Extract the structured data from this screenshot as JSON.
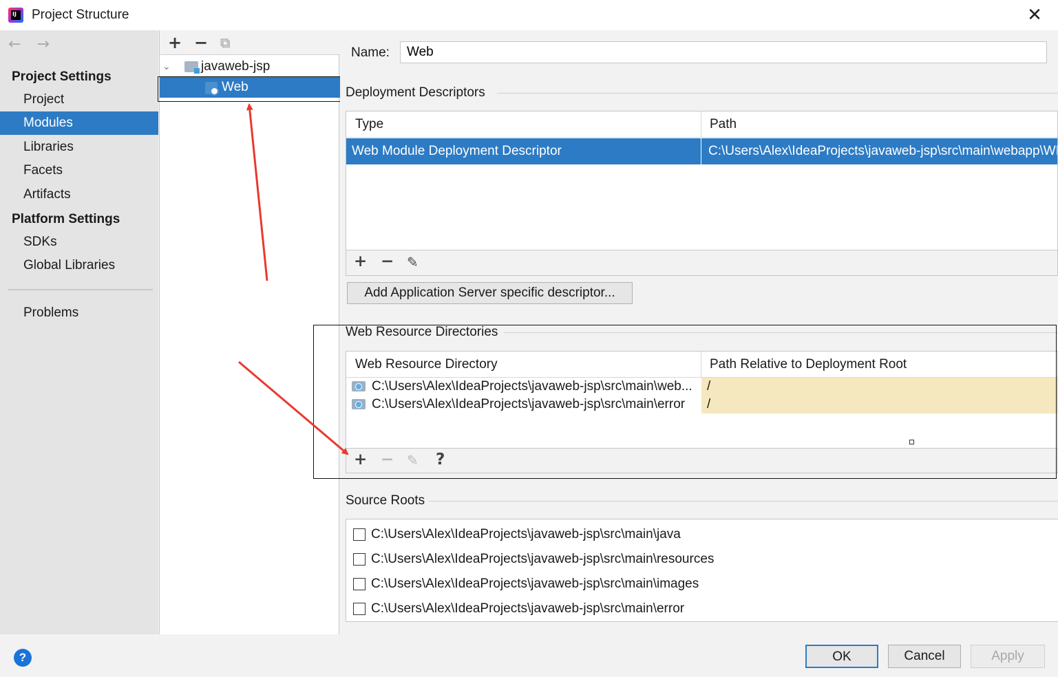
{
  "window": {
    "title": "Project Structure",
    "close": "✕"
  },
  "nav": {
    "back": "←",
    "forward": "→",
    "project_settings": "Project Settings",
    "items_top": [
      "Project",
      "Modules",
      "Libraries",
      "Facets",
      "Artifacts"
    ],
    "platform_settings": "Platform Settings",
    "items_platform": [
      "SDKs",
      "Global Libraries"
    ],
    "problems": "Problems",
    "selected": "Modules"
  },
  "tree": {
    "toolbar": {
      "add": "+",
      "remove": "−",
      "copy": "⧉"
    },
    "root": "javaweb-jsp",
    "child": "Web"
  },
  "form": {
    "name_label": "Name:",
    "name_value": "Web"
  },
  "deployment": {
    "title": "Deployment Descriptors",
    "col_type": "Type",
    "col_path": "Path",
    "rows": [
      {
        "type": "Web Module Deployment Descriptor",
        "path": "C:\\Users\\Alex\\IdeaProjects\\javaweb-jsp\\src\\main\\webapp\\WEB-INF\\web.xml"
      }
    ],
    "add_server_button": "Add Application Server specific descriptor..."
  },
  "web_resources": {
    "title": "Web Resource Directories",
    "col_dir": "Web Resource Directory",
    "col_rel": "Path Relative to Deployment Root",
    "rows": [
      {
        "dir": "C:\\Users\\Alex\\IdeaProjects\\javaweb-jsp\\src\\main\\web...",
        "rel": "/"
      },
      {
        "dir": "C:\\Users\\Alex\\IdeaProjects\\javaweb-jsp\\src\\main\\error",
        "rel": "/"
      }
    ],
    "help": "?"
  },
  "source_roots": {
    "title": "Source Roots",
    "items": [
      "C:\\Users\\Alex\\IdeaProjects\\javaweb-jsp\\src\\main\\java",
      "C:\\Users\\Alex\\IdeaProjects\\javaweb-jsp\\src\\main\\resources",
      "C:\\Users\\Alex\\IdeaProjects\\javaweb-jsp\\src\\main\\images",
      "C:\\Users\\Alex\\IdeaProjects\\javaweb-jsp\\src\\main\\error"
    ]
  },
  "footer": {
    "help": "?",
    "ok": "OK",
    "cancel": "Cancel",
    "apply": "Apply"
  },
  "colors": {
    "selection": "#2d7bc4",
    "annotation_arrow": "#e8392f",
    "relative_path_bg": "#f5e8be"
  }
}
